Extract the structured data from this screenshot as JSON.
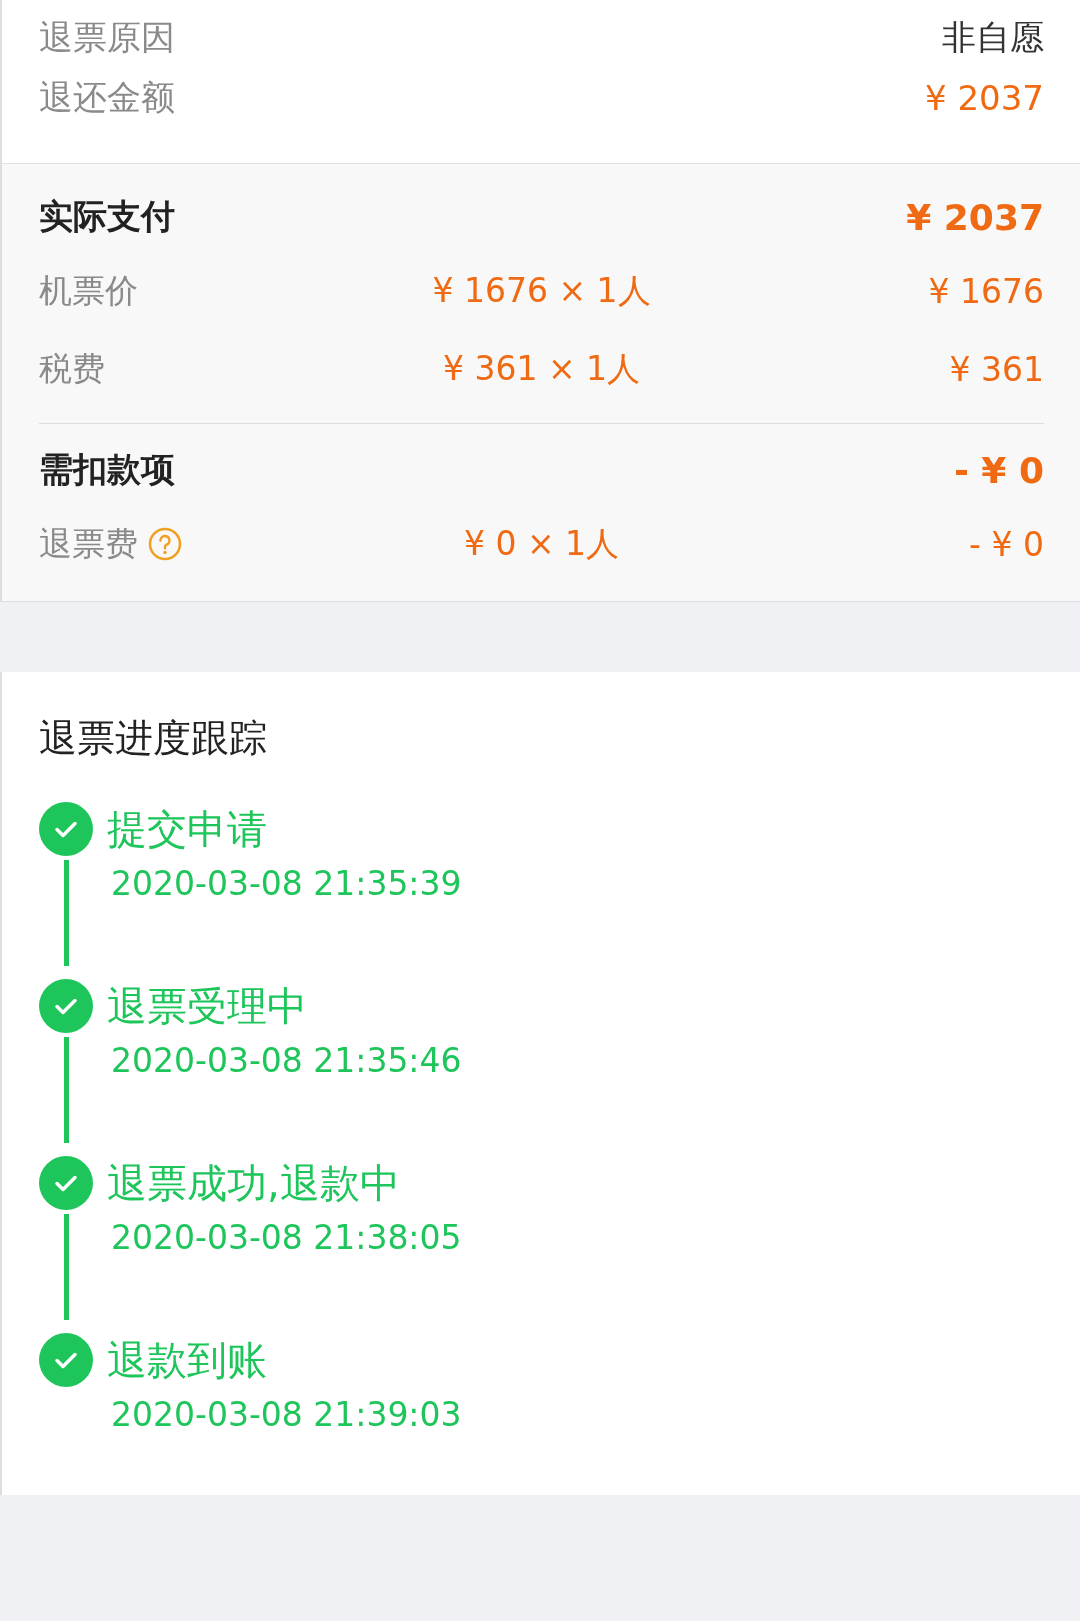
{
  "refund_info": [
    {
      "label": "退票原因",
      "value": "非自愿",
      "highlight": false
    },
    {
      "label": "退还金额",
      "value": "¥ 2037",
      "highlight": true
    }
  ],
  "payment": {
    "title": "实际支付",
    "total": "¥ 2037",
    "items": [
      {
        "label": "机票价",
        "unit": "¥ 1676 × 1人",
        "amount": "¥ 1676",
        "help": false
      },
      {
        "label": "税费",
        "unit": "¥ 361 × 1人",
        "amount": "¥ 361",
        "help": false
      }
    ]
  },
  "deductions": {
    "title": "需扣款项",
    "total": "- ¥ 0",
    "items": [
      {
        "label": "退票费",
        "unit": "¥ 0 × 1人",
        "amount": "- ¥ 0",
        "help": true
      }
    ]
  },
  "progress": {
    "title": "退票进度跟踪",
    "steps": [
      {
        "title": "提交申请",
        "time": "2020-03-08 21:35:39",
        "done": true
      },
      {
        "title": "退票受理中",
        "time": "2020-03-08 21:35:46",
        "done": true
      },
      {
        "title": "退票成功,退款中",
        "time": "2020-03-08 21:38:05",
        "done": true
      },
      {
        "title": "退款到账",
        "time": "2020-03-08 21:39:03",
        "done": true
      }
    ]
  }
}
